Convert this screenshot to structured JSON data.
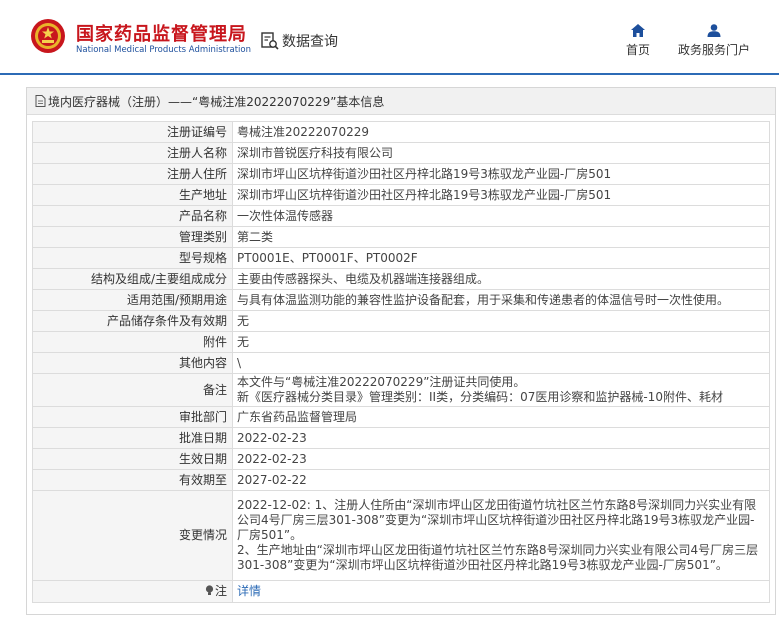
{
  "header": {
    "site_name_cn": "国家药品监督管理局",
    "site_name_en": "National Medical Products Administration",
    "data_query_label": "数据查询",
    "nav": {
      "home": "首页",
      "portal": "政务服务门户"
    },
    "colors": {
      "brand_red": "#c8161d",
      "brand_blue": "#2c6bb6"
    }
  },
  "panel": {
    "title": "境内医疗器械（注册）——“粤械注准20222070229”基本信息"
  },
  "rows": [
    {
      "label": "注册证编号",
      "value": "粤械注准20222070229"
    },
    {
      "label": "注册人名称",
      "value": "深圳市普锐医疗科技有限公司"
    },
    {
      "label": "注册人住所",
      "value": "深圳市坪山区坑梓街道沙田社区丹梓北路19号3栋驭龙产业园-厂房501"
    },
    {
      "label": "生产地址",
      "value": "深圳市坪山区坑梓街道沙田社区丹梓北路19号3栋驭龙产业园-厂房501"
    },
    {
      "label": "产品名称",
      "value": "一次性体温传感器"
    },
    {
      "label": "管理类别",
      "value": "第二类"
    },
    {
      "label": "型号规格",
      "value": "PT0001E、PT0001F、PT0002F"
    },
    {
      "label": "结构及组成/主要组成成分",
      "value": "主要由传感器探头、电缆及机器端连接器组成。"
    },
    {
      "label": "适用范围/预期用途",
      "value": "与具有体温监测功能的兼容性监护设备配套，用于采集和传递患者的体温信号时一次性使用。"
    },
    {
      "label": "产品储存条件及有效期",
      "value": "无"
    },
    {
      "label": "附件",
      "value": "无"
    },
    {
      "label": "其他内容",
      "value": "\\"
    },
    {
      "label": "备注",
      "value_lines": [
        "本文件与“粤械注准20222070229”注册证共同使用。",
        "新《医疗器械分类目录》管理类别：II类，分类编码：07医用诊察和监护器械-10附件、耗材"
      ]
    },
    {
      "label": "审批部门",
      "value": "广东省药品监督管理局"
    },
    {
      "label": "批准日期",
      "value": "2022-02-23"
    },
    {
      "label": "生效日期",
      "value": "2022-02-23"
    },
    {
      "label": "有效期至",
      "value": "2027-02-22"
    },
    {
      "label": "变更情况",
      "value_lines": [
        "2022-12-02: 1、注册人住所由“深圳市坪山区龙田街道竹坑社区兰竹东路8号深圳同力兴实业有限公司4号厂房三层301-308”变更为“深圳市坪山区坑梓街道沙田社区丹梓北路19号3栋驭龙产业园-厂房501”。",
        "2、生产地址由“深圳市坪山区龙田街道竹坑社区兰竹东路8号深圳同力兴实业有限公司4号厂房三层301-308”变更为“深圳市坪山区坑梓街道沙田社区丹梓北路19号3栋驭龙产业园-厂房501”。"
      ]
    },
    {
      "label": "注",
      "value": "详情"
    }
  ]
}
